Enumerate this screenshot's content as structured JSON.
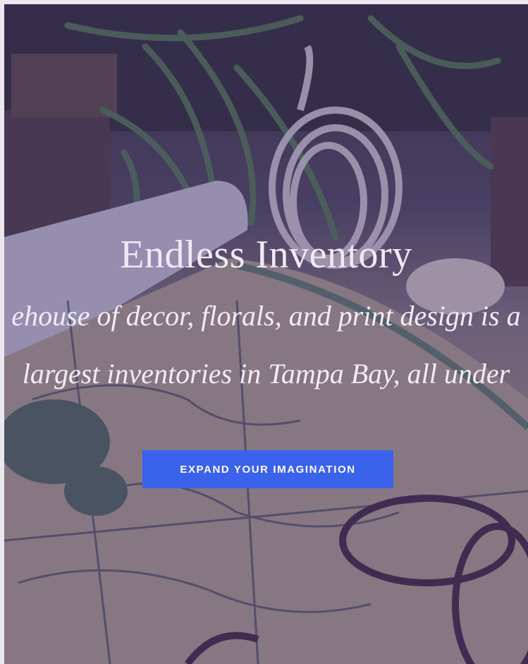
{
  "hero": {
    "title": "Endless Inventory",
    "description_lines": [
      "ehouse of decor, florals, and print design is a",
      "largest inventories in Tampa Bay, all under"
    ],
    "cta_label": "EXPAND YOUR IMAGINATION",
    "cta_color": "#3b62ea",
    "overlay_color": "#483476"
  }
}
